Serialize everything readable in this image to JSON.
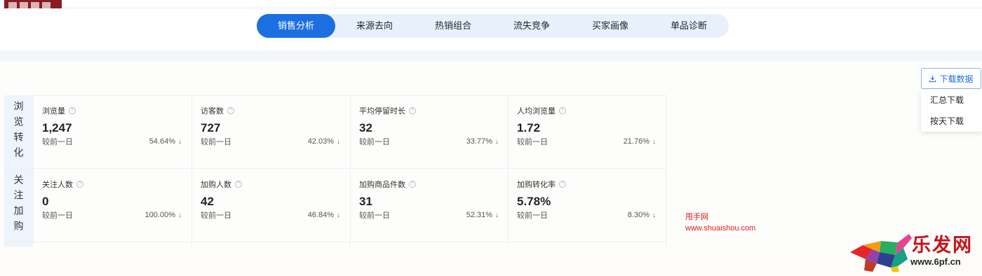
{
  "tabs": [
    {
      "label": "销售分析",
      "active": true
    },
    {
      "label": "来源去向",
      "active": false
    },
    {
      "label": "热销组合",
      "active": false
    },
    {
      "label": "流失竞争",
      "active": false
    },
    {
      "label": "买家画像",
      "active": false
    },
    {
      "label": "单品诊断",
      "active": false
    }
  ],
  "download": {
    "label": "下载数据",
    "icon": "download-icon",
    "options": [
      "汇总下载",
      "按天下载"
    ]
  },
  "sections": [
    {
      "label": "浏览转化",
      "metrics": [
        {
          "name": "浏览量",
          "value": "1,247",
          "compare": "较前一日",
          "change": "54.64%",
          "trend": "down"
        },
        {
          "name": "访客数",
          "value": "727",
          "compare": "较前一日",
          "change": "42.03%",
          "trend": "down"
        },
        {
          "name": "平均停留时长",
          "value": "32",
          "compare": "较前一日",
          "change": "33.77%",
          "trend": "down"
        },
        {
          "name": "人均浏览量",
          "value": "1.72",
          "compare": "较前一日",
          "change": "21.76%",
          "trend": "down"
        }
      ]
    },
    {
      "label": "关注加购",
      "metrics": [
        {
          "name": "关注人数",
          "value": "0",
          "compare": "较前一日",
          "change": "100.00%",
          "trend": "down"
        },
        {
          "name": "加购人数",
          "value": "42",
          "compare": "较前一日",
          "change": "46.84%",
          "trend": "down"
        },
        {
          "name": "加购商品件数",
          "value": "31",
          "compare": "较前一日",
          "change": "52.31%",
          "trend": "down"
        },
        {
          "name": "加购转化率",
          "value": "5.78%",
          "compare": "较前一日",
          "change": "8.30%",
          "trend": "down"
        }
      ]
    }
  ],
  "watermark": {
    "line1": "甩手网",
    "line2": "www.shuaishou.com"
  },
  "brand": {
    "name": "乐发网",
    "site": "www.6pf.cn"
  },
  "colors": {
    "accent": "#1c6fe0",
    "tab_bg": "#e8f1fb",
    "section_bg": "#eef4fb",
    "down_arrow": "#1f9d55",
    "watermark": "#e01a1a"
  }
}
